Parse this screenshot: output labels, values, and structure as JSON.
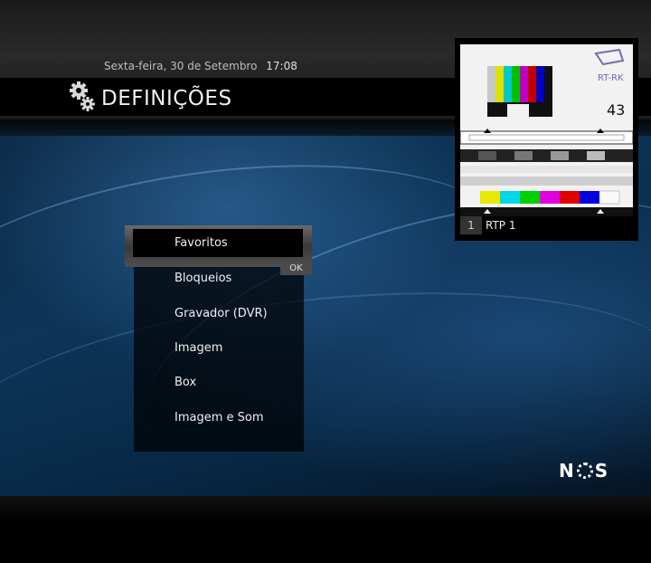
{
  "header": {
    "date": "Sexta-feira, 30 de Setembro",
    "time": "17:08",
    "title": "DEFINIÇÕES",
    "icon": "gear-icon"
  },
  "menu": {
    "items": [
      {
        "label": "Favoritos",
        "selected": true
      },
      {
        "label": "Bloqueios"
      },
      {
        "label": "Gravador (DVR)"
      },
      {
        "label": "Imagem"
      },
      {
        "label": "Box"
      },
      {
        "label": "Imagem e Som"
      }
    ],
    "ok_label": "OK"
  },
  "preview": {
    "channel_number": "1",
    "channel_name": "RTP 1",
    "test_card_logo": "RT-RK",
    "test_card_number": "43"
  },
  "brand": {
    "logo_text_left": "N",
    "logo_text_right": "S"
  },
  "colors": {
    "background_blue": "#0b3658",
    "selection_frame": "#5a5a5a"
  }
}
